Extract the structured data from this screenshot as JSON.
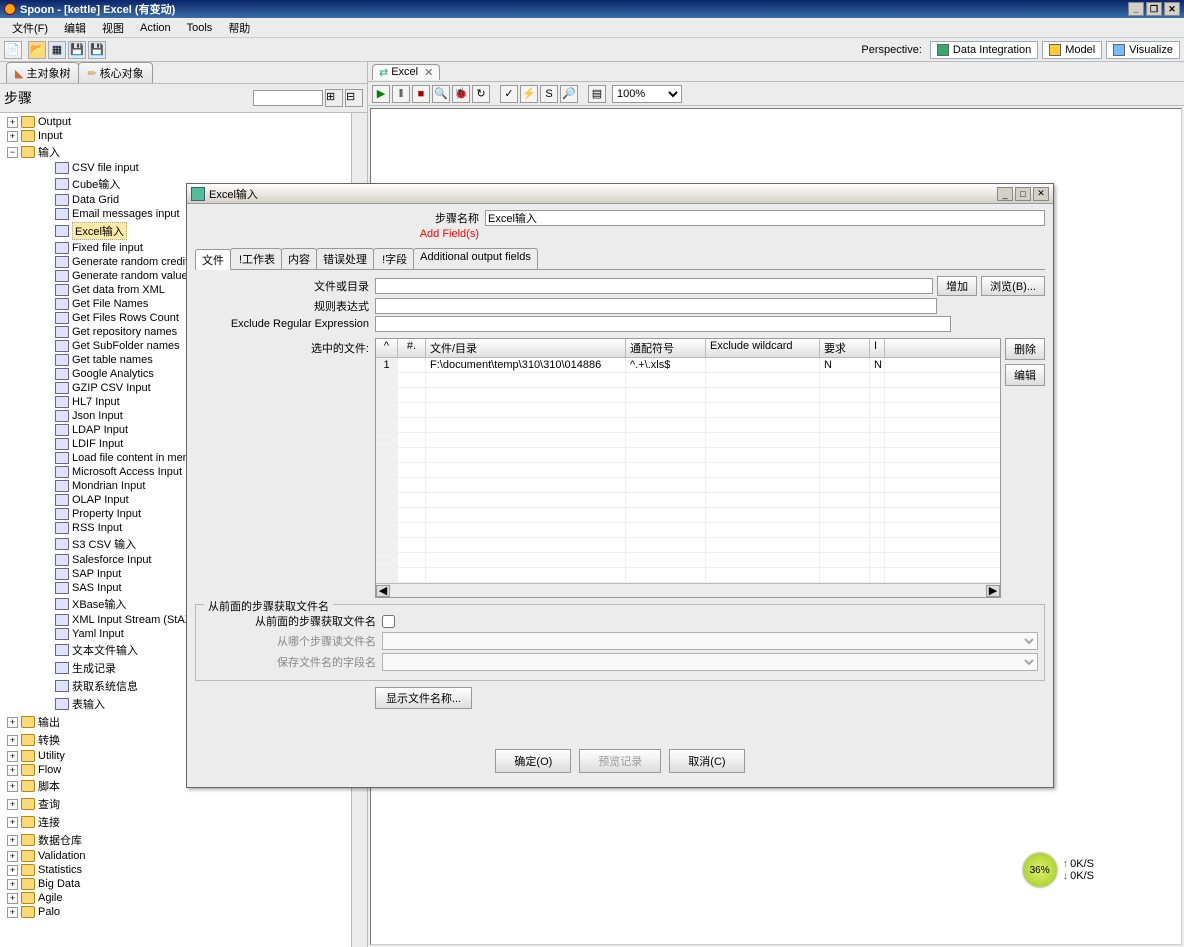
{
  "titlebar": {
    "text": "Spoon - [kettle] Excel (有变动)"
  },
  "menu": [
    "文件(F)",
    "编辑",
    "视图",
    "Action",
    "Tools",
    "帮助"
  ],
  "perspective": {
    "label": "Perspective:",
    "items": [
      "Data Integration",
      "Model",
      "Visualize"
    ]
  },
  "sidetabs": [
    {
      "label": "主对象树"
    },
    {
      "label": "核心对象"
    }
  ],
  "stepheader": {
    "label": "步骤",
    "filter": ""
  },
  "tree": {
    "output": "Output",
    "input_en": "Input",
    "input_cn": "输入",
    "items": [
      "CSV file input",
      "Cube输入",
      "Data Grid",
      "Email messages input",
      "Excel输入",
      "Fixed file input",
      "Generate random credit car",
      "Generate random value",
      "Get data from XML",
      "Get File Names",
      "Get Files Rows Count",
      "Get repository names",
      "Get SubFolder names",
      "Get table names",
      "Google Analytics",
      "GZIP CSV Input",
      "HL7 Input",
      "Json Input",
      "LDAP Input",
      "LDIF Input",
      "Load file content in memory",
      "Microsoft Access Input",
      "Mondrian Input",
      "OLAP Input",
      "Property Input",
      "RSS Input",
      "S3 CSV 输入",
      "Salesforce Input",
      "SAP Input",
      "SAS Input",
      "XBase输入",
      "XML Input Stream (StAX)",
      "Yaml Input",
      "文本文件输入",
      "生成记录",
      "获取系统信息",
      "表输入"
    ],
    "folders": [
      "输出",
      "转换",
      "Utility",
      "Flow",
      "脚本",
      "查询",
      "连接",
      "数据仓库",
      "Validation",
      "Statistics",
      "Big Data",
      "Agile",
      "Palo"
    ],
    "selected": "Excel输入"
  },
  "worktab": {
    "label": "Excel"
  },
  "zoom": "100%",
  "dialog": {
    "title": "Excel输入",
    "step_name_label": "步骤名称",
    "step_name_value": "Excel输入",
    "add_fields": "Add Field(s)",
    "tabs": [
      "文件",
      "!工作表",
      "内容",
      "错误处理",
      "!字段",
      "Additional output fields"
    ],
    "file_or_dir": "文件或目录",
    "regex": "规则表达式",
    "exclude_regex": "Exclude Regular Expression",
    "btn_add": "增加",
    "btn_browse": "浏览(B)...",
    "selected_files": "选中的文件:",
    "thead": [
      "^",
      "#.",
      "文件/目录",
      "通配符号",
      "Exclude wildcard",
      "要求",
      "I"
    ],
    "row1": {
      "num": "1",
      "path": "F:\\document\\temp\\310\\310\\014886",
      "wildcard": "^.+\\.xls$",
      "exclude": "",
      "required": "N",
      "i": "N"
    },
    "btn_delete": "删除",
    "btn_edit": "编辑",
    "group_title": "从前面的步骤获取文件名",
    "from_step_label": "从前面的步骤获取文件名",
    "which_step": "从哪个步骤读文件名",
    "field_name": "保存文件名的字段名",
    "show_names": "显示文件名称...",
    "ok": "确定(O)",
    "preview": "预览记录",
    "cancel": "取消(C)"
  },
  "speed": {
    "percent": "36%",
    "up": "0K/S",
    "down": "0K/S"
  }
}
